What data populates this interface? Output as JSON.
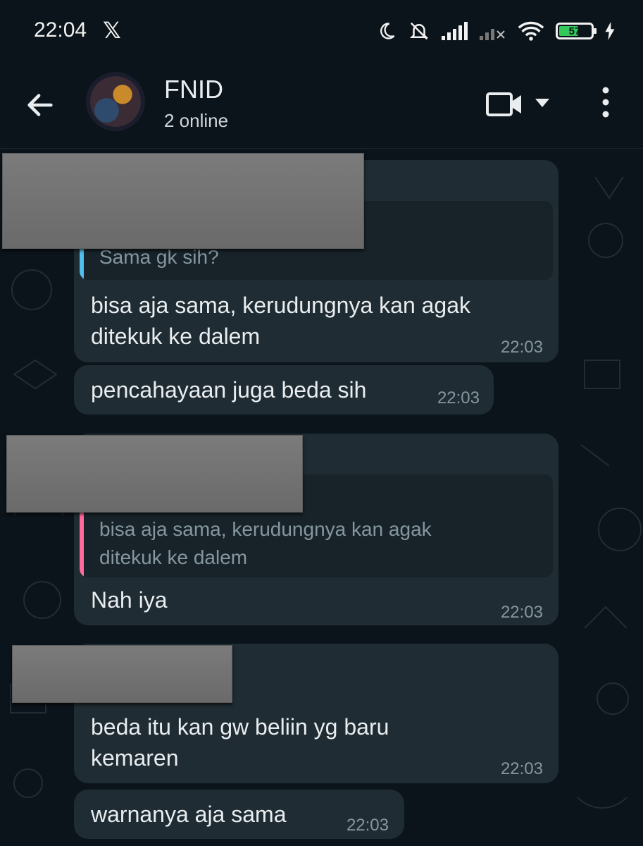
{
  "status_bar": {
    "time": "22:04",
    "x_logo": "𝕏",
    "battery_level": "57",
    "icons": [
      "moon-icon",
      "mute-bell-icon",
      "signal-icon",
      "signal-off-icon",
      "wifi-icon",
      "battery-icon",
      "charging-icon"
    ]
  },
  "header": {
    "back_icon": "arrow-left-icon",
    "title": "FNID",
    "subtitle": "2 online",
    "video_icon": "video-call-icon",
    "dropdown_icon": "caret-down-icon",
    "menu_icon": "more-vert-icon"
  },
  "messages": [
    {
      "quote": "Sama gk sih?",
      "text": "bisa aja sama, kerudungnya kan agak\nditekuk ke dalem",
      "time": "22:03"
    },
    {
      "text": "pencahayaan juga beda sih",
      "time": "22:03"
    },
    {
      "quote": "bisa aja sama, kerudungnya kan agak\nditekuk ke dalem",
      "text": "Nah iya",
      "time": "22:03"
    },
    {
      "text": "beda itu kan gw beliin yg baru\nkemaren",
      "time": "22:03"
    },
    {
      "text": "warnanya aja sama",
      "time": "22:03"
    }
  ],
  "colors": {
    "background": "#0b141a",
    "bubble": "#1f2c33",
    "quote_bar_blue": "#53bdeb",
    "quote_bar_pink": "#ff6b9a",
    "meta_text": "#8696a0"
  }
}
